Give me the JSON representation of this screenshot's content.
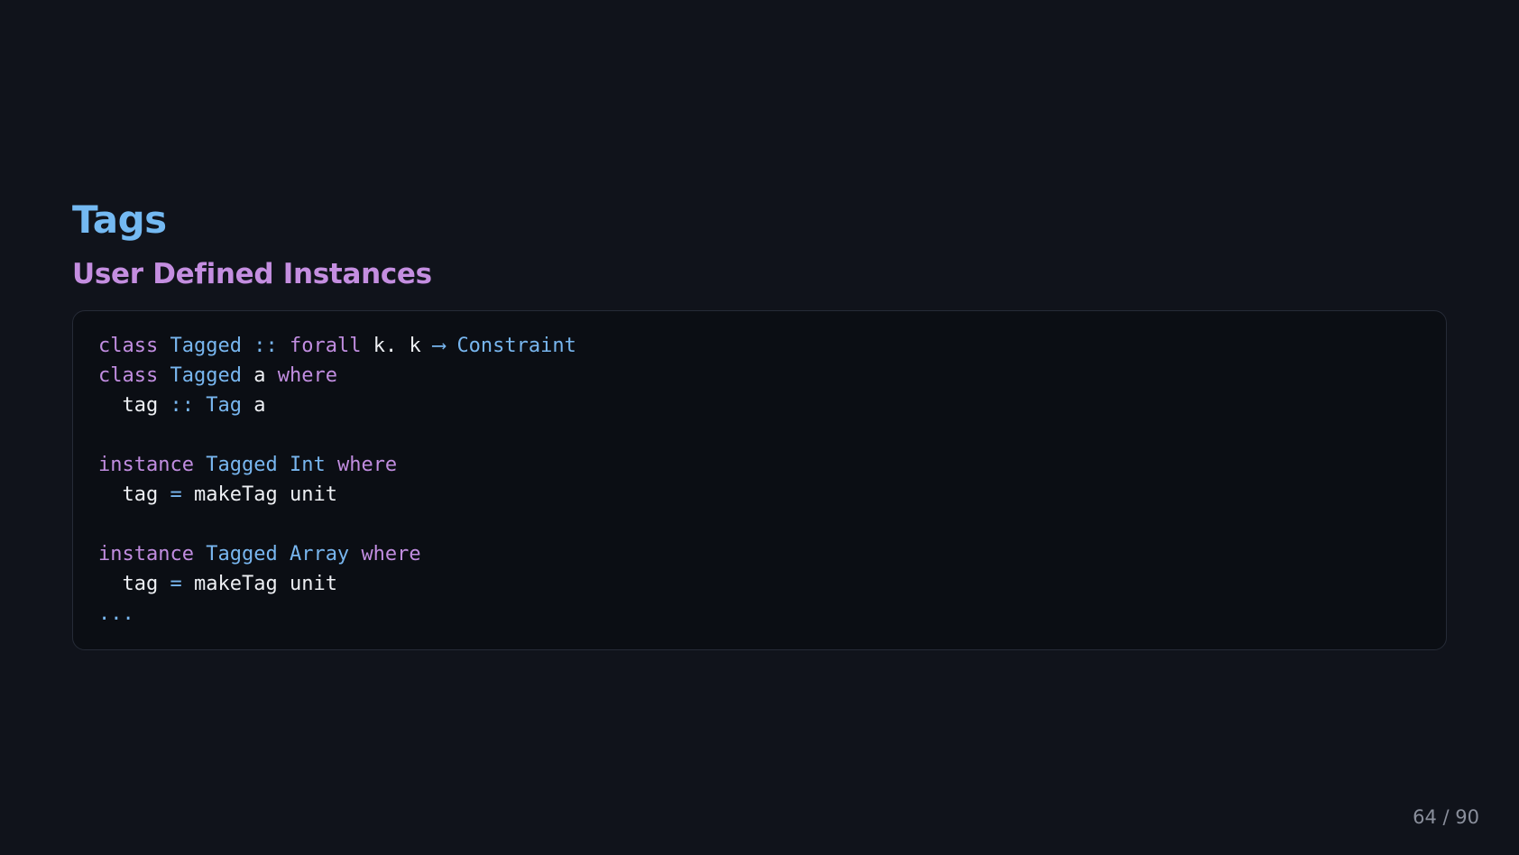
{
  "slide": {
    "title": "Tags",
    "subtitle": "User Defined Instances",
    "page_counter": "64 / 90"
  },
  "code": {
    "l1": {
      "t1": "class",
      "t2": "Tagged",
      "t3": "::",
      "t4": "forall",
      "t5": "k. k",
      "t6": "⟶",
      "t7": "Constraint"
    },
    "l2": {
      "t1": "class",
      "t2": "Tagged",
      "t3": "a",
      "t4": "where"
    },
    "l3": {
      "t1": "tag",
      "t2": "::",
      "t3": "Tag",
      "t4": "a"
    },
    "l5": {
      "t1": "instance",
      "t2": "Tagged",
      "t3": "Int",
      "t4": "where"
    },
    "l6": {
      "t1": "tag",
      "t2": "=",
      "t3": "makeTag unit"
    },
    "l8": {
      "t1": "instance",
      "t2": "Tagged",
      "t3": "Array",
      "t4": "where"
    },
    "l9": {
      "t1": "tag",
      "t2": "=",
      "t3": "makeTag unit"
    },
    "l10": {
      "t1": "..."
    }
  },
  "colors": {
    "background": "#10131b",
    "title": "#74b9f2",
    "subtitle": "#c48ee0",
    "keyword": "#c18de0",
    "type": "#78b6ef"
  }
}
